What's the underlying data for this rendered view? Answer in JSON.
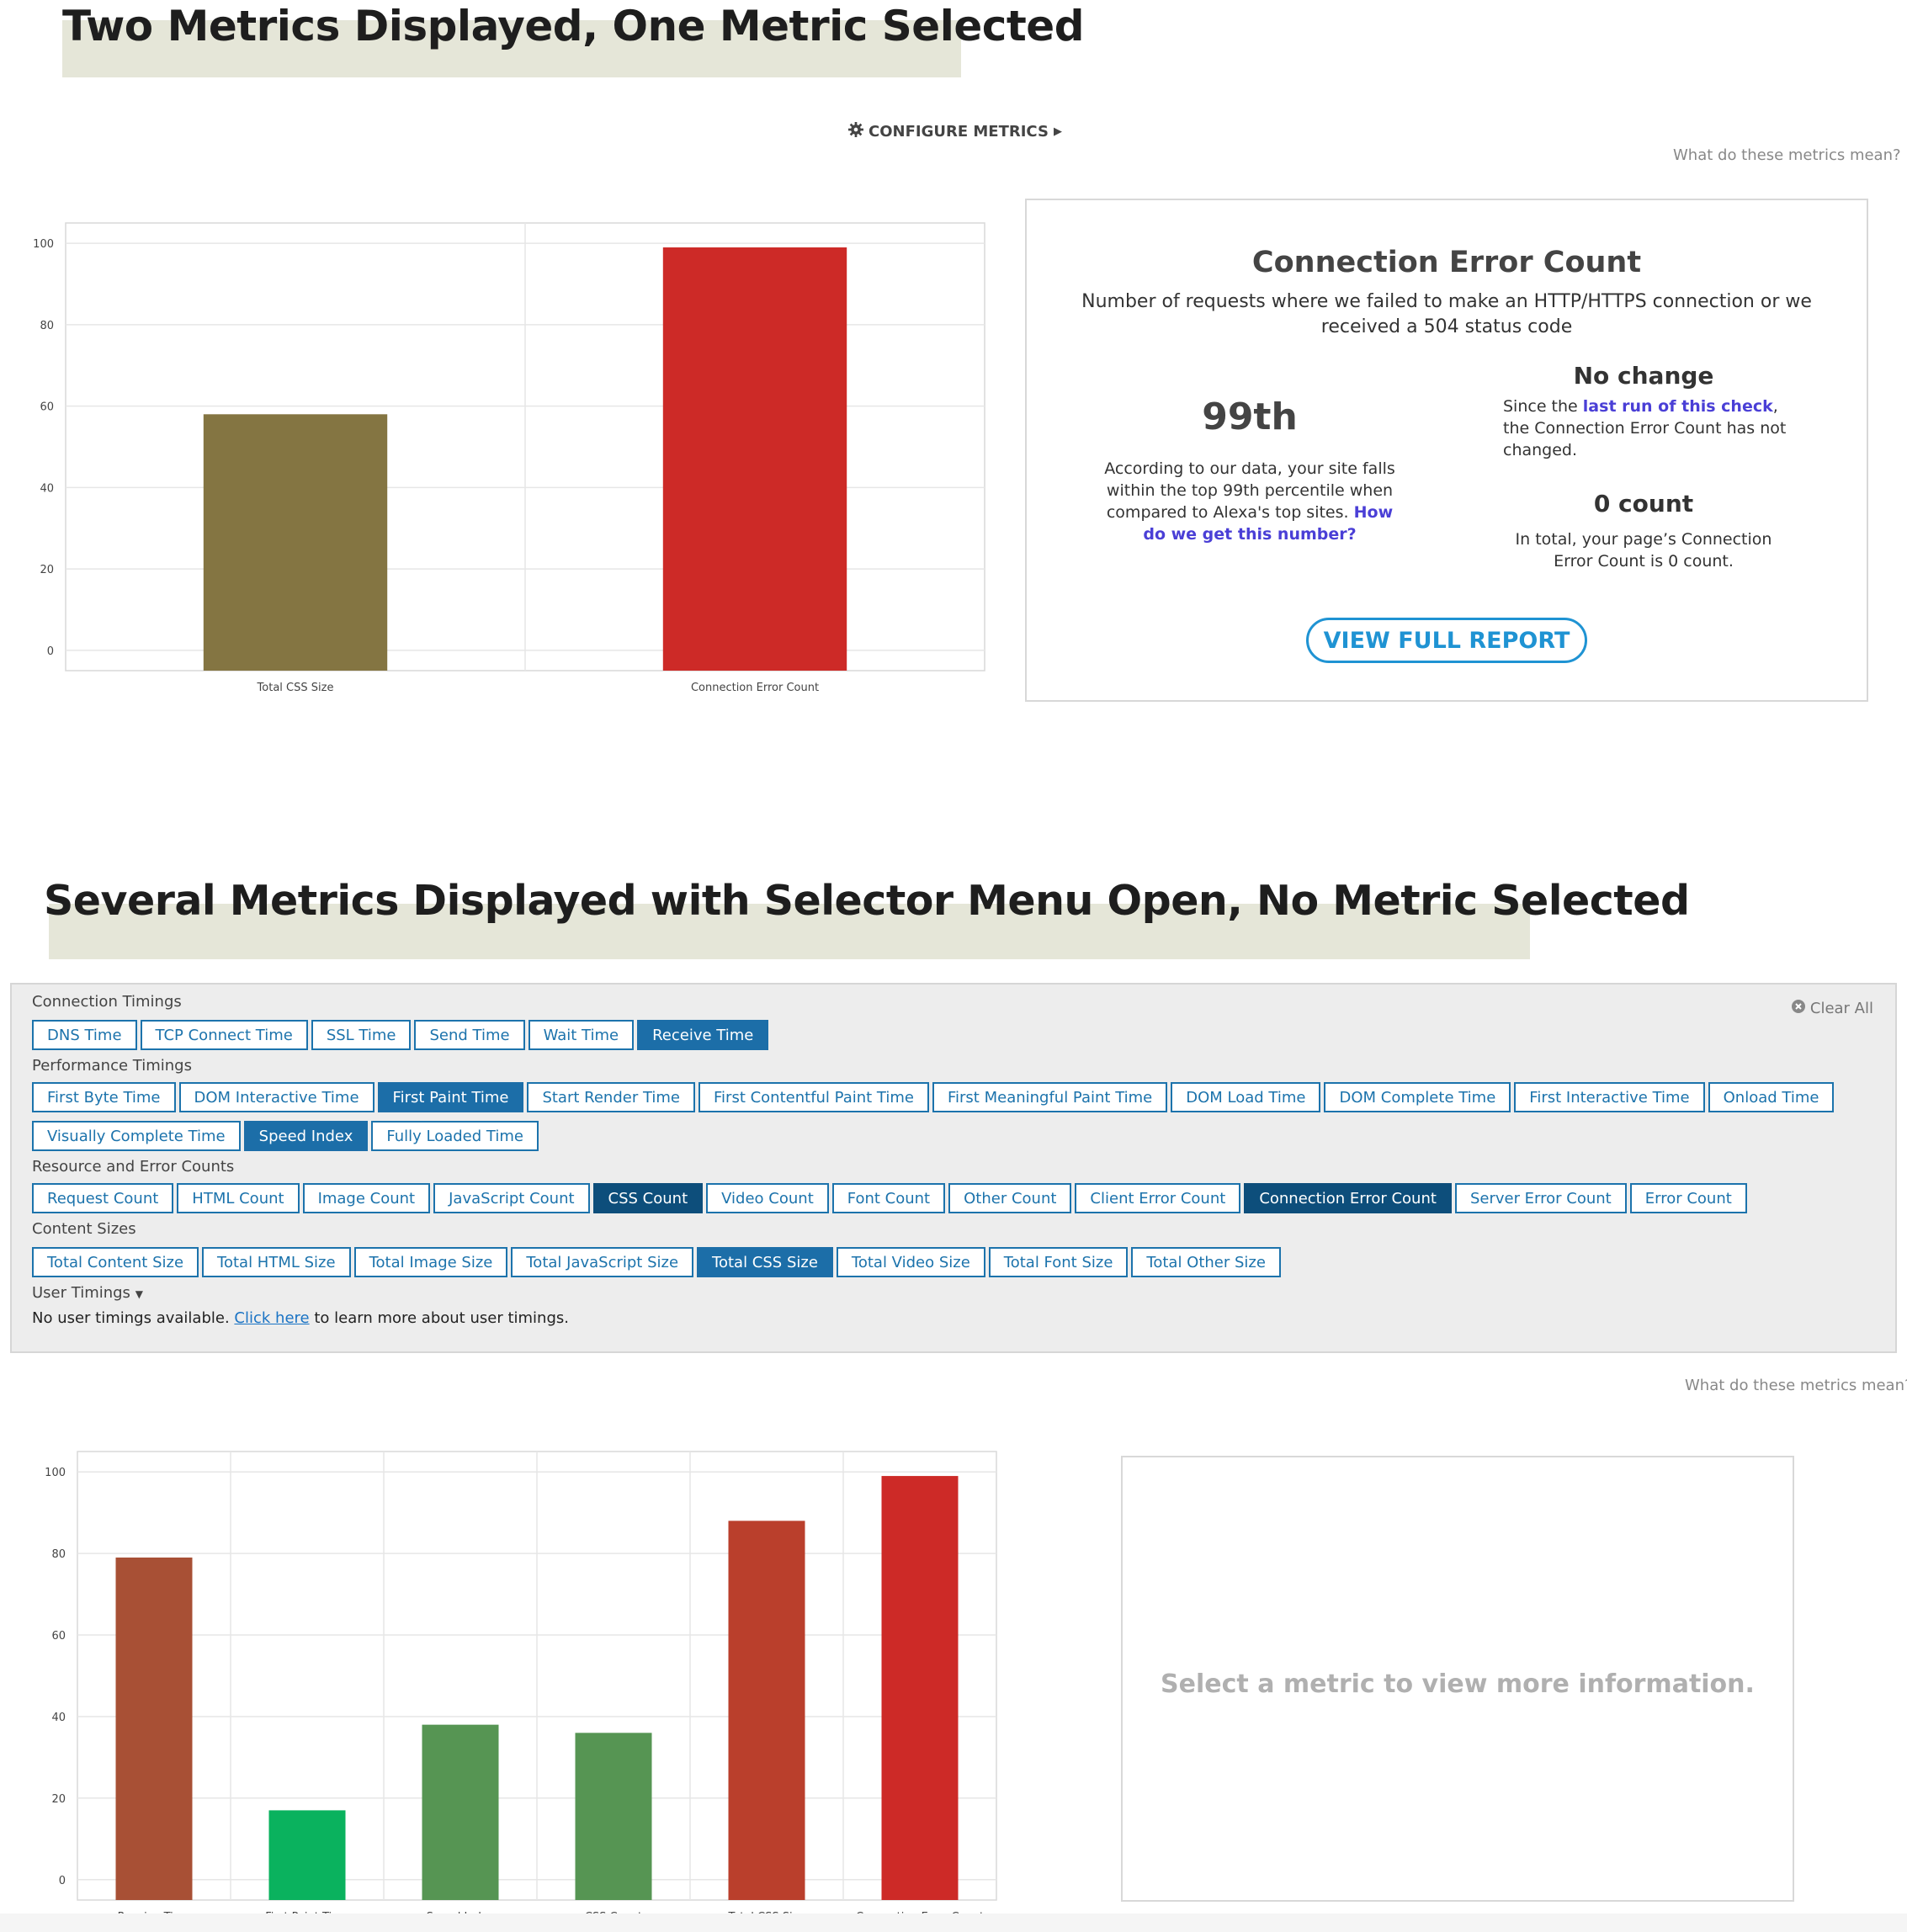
{
  "section1": {
    "heading": "Two Metrics Displayed, One Metric Selected"
  },
  "toolbar": {
    "configure_label": "CONFIGURE METRICS",
    "what_mean": "What do these metrics mean?"
  },
  "chart_data": [
    {
      "type": "bar",
      "categories": [
        "Total CSS Size",
        "Connection Error Count"
      ],
      "values": [
        58,
        99
      ],
      "colors": [
        "#847542",
        "#cd2a27"
      ],
      "ylim": [
        -5,
        105
      ],
      "yticks": [
        0,
        20,
        40,
        60,
        80,
        100
      ],
      "grid": true
    },
    {
      "type": "bar",
      "categories": [
        "Receive Time",
        "First Paint Time",
        "Speed Index",
        "CSS Count",
        "Total CSS Size",
        "Connection Error Count"
      ],
      "values": [
        79,
        17,
        38,
        36,
        88,
        99
      ],
      "colors": [
        "#a85035",
        "#0ab25e",
        "#569553",
        "#569553",
        "#ba3f2c",
        "#cd2a27"
      ],
      "ylim": [
        -5,
        105
      ],
      "yticks": [
        0,
        20,
        40,
        60,
        80,
        100
      ],
      "grid": true
    }
  ],
  "info": {
    "title": "Connection Error Count",
    "description": "Number of requests where we failed to make an HTTP/HTTPS connection or we received a 504 status code",
    "percentile": "99th",
    "percentile_text": "According to our data, your site falls within the top 99th percentile when compared to Alexa's top sites.",
    "percentile_link": "How do we get this number?",
    "change_title": "No change",
    "change_pre": "Since the",
    "change_link": "last run of this check",
    "change_post": ", the Connection Error Count has not changed.",
    "count_title": "0 count",
    "count_text": "In total, your page’s Connection Error Count is 0 count.",
    "button": "VIEW FULL REPORT"
  },
  "section2": {
    "heading": "Several Metrics Displayed with Selector Menu Open, No Metric Selected"
  },
  "selector": {
    "clear_all": "Clear All",
    "groups": [
      {
        "label": "Connection Timings",
        "rows": [
          [
            {
              "label": "DNS Time",
              "state": ""
            },
            {
              "label": "TCP Connect Time",
              "state": ""
            },
            {
              "label": "SSL Time",
              "state": ""
            },
            {
              "label": "Send Time",
              "state": ""
            },
            {
              "label": "Wait Time",
              "state": ""
            },
            {
              "label": "Receive Time",
              "state": "active"
            }
          ]
        ]
      },
      {
        "label": "Performance Timings",
        "rows": [
          [
            {
              "label": "First Byte Time",
              "state": ""
            },
            {
              "label": "DOM Interactive Time",
              "state": ""
            },
            {
              "label": "First Paint Time",
              "state": "active"
            },
            {
              "label": "Start Render Time",
              "state": ""
            },
            {
              "label": "First Contentful Paint Time",
              "state": ""
            },
            {
              "label": "First Meaningful Paint Time",
              "state": ""
            },
            {
              "label": "DOM Load Time",
              "state": ""
            },
            {
              "label": "DOM Complete Time",
              "state": ""
            },
            {
              "label": "First Interactive Time",
              "state": ""
            },
            {
              "label": "Onload Time",
              "state": ""
            }
          ],
          [
            {
              "label": "Visually Complete Time",
              "state": ""
            },
            {
              "label": "Speed Index",
              "state": "active"
            },
            {
              "label": "Fully Loaded Time",
              "state": ""
            }
          ]
        ]
      },
      {
        "label": "Resource and Error Counts",
        "rows": [
          [
            {
              "label": "Request Count",
              "state": ""
            },
            {
              "label": "HTML Count",
              "state": ""
            },
            {
              "label": "Image Count",
              "state": ""
            },
            {
              "label": "JavaScript Count",
              "state": ""
            },
            {
              "label": "CSS Count",
              "state": "dark"
            },
            {
              "label": "Video Count",
              "state": ""
            },
            {
              "label": "Font Count",
              "state": ""
            },
            {
              "label": "Other Count",
              "state": ""
            },
            {
              "label": "Client Error Count",
              "state": ""
            },
            {
              "label": "Connection Error Count",
              "state": "dark"
            },
            {
              "label": "Server Error Count",
              "state": ""
            },
            {
              "label": "Error Count",
              "state": ""
            }
          ]
        ]
      },
      {
        "label": "Content Sizes",
        "rows": [
          [
            {
              "label": "Total Content Size",
              "state": ""
            },
            {
              "label": "Total HTML Size",
              "state": ""
            },
            {
              "label": "Total Image Size",
              "state": ""
            },
            {
              "label": "Total JavaScript Size",
              "state": ""
            },
            {
              "label": "Total CSS Size",
              "state": "active"
            },
            {
              "label": "Total Video Size",
              "state": ""
            },
            {
              "label": "Total Font Size",
              "state": ""
            },
            {
              "label": "Total Other Size",
              "state": ""
            }
          ]
        ]
      }
    ],
    "user_timings_label": "User Timings",
    "user_note_pre": "No user timings available.",
    "user_note_link": "Click here",
    "user_note_post": "to learn more about user timings."
  },
  "empty_panel": {
    "text": "Select a metric to view more information."
  }
}
